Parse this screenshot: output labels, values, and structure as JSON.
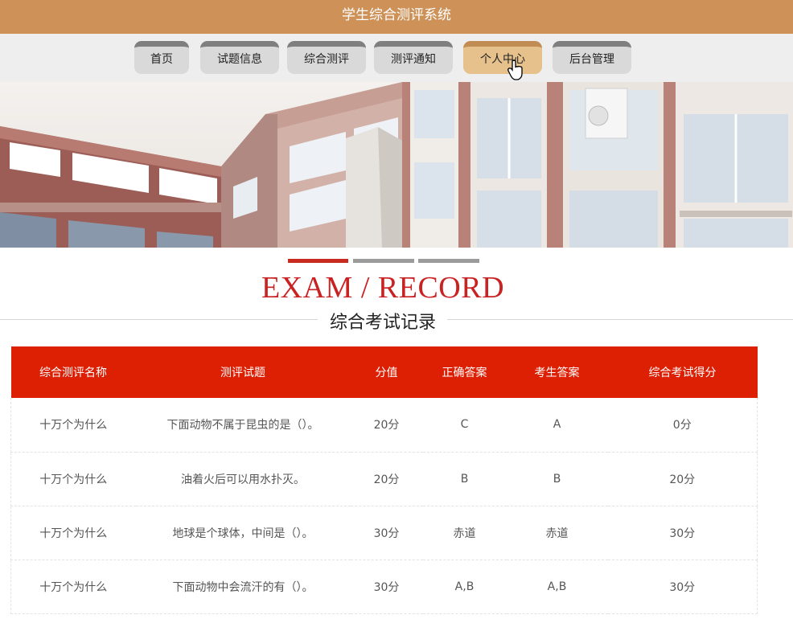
{
  "app": {
    "title": "学生综合测评系统"
  },
  "nav": {
    "items": [
      {
        "label": "首页"
      },
      {
        "label": "试题信息"
      },
      {
        "label": "综合测评"
      },
      {
        "label": "测评通知"
      },
      {
        "label": "个人中心",
        "active": true
      },
      {
        "label": "后台管理"
      }
    ]
  },
  "section": {
    "title_en": "EXAM / RECORD",
    "title_cn": "综合考试记录"
  },
  "table": {
    "headers": [
      "综合测评名称",
      "测评试题",
      "分值",
      "正确答案",
      "考生答案",
      "综合考试得分"
    ],
    "rows": [
      [
        "十万个为什么",
        "下面动物不属于昆虫的是（）。",
        "20分",
        "C",
        "A",
        "0分"
      ],
      [
        "十万个为什么",
        "油着火后可以用水扑灭。",
        "20分",
        "B",
        "B",
        "20分"
      ],
      [
        "十万个为什么",
        "地球是个球体，中间是（）。",
        "30分",
        "赤道",
        "赤道",
        "30分"
      ],
      [
        "十万个为什么",
        "下面动物中会流汗的有（）。",
        "30分",
        "A,B",
        "A,B",
        "30分"
      ]
    ]
  },
  "colors": {
    "topbar": "#ce9258",
    "nav_active": "#e6c18c",
    "accent_red": "#dd1f04",
    "heading_red": "#c82222"
  }
}
